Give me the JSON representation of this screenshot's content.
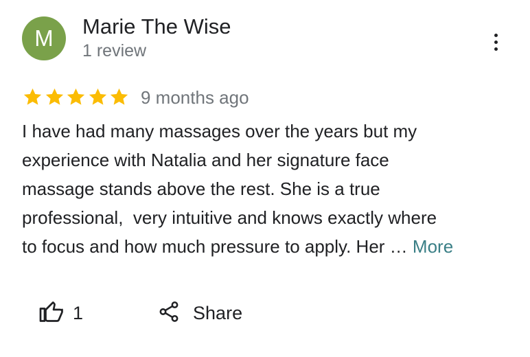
{
  "review": {
    "author": {
      "initial": "M",
      "name": "Marie The Wise",
      "review_count": "1 review",
      "avatar_color": "#7aa14a"
    },
    "rating": 5,
    "rating_max": 5,
    "star_color": "#fbbc04",
    "date": "9 months ago",
    "text_lines": [
      "I have had many massages over the years but my",
      "experience with Natalia and her signature face",
      "massage stands above the rest. She is a true",
      "professional,  very intuitive and knows exactly where",
      "to focus and how much pressure to apply. Her …"
    ],
    "more_label": "More",
    "more_color": "#3a7f86",
    "menu_icon": "more-vert-icon"
  },
  "actions": {
    "like_icon": "thumb-up-icon",
    "like_count": "1",
    "share_icon": "share-icon",
    "share_label": "Share"
  }
}
